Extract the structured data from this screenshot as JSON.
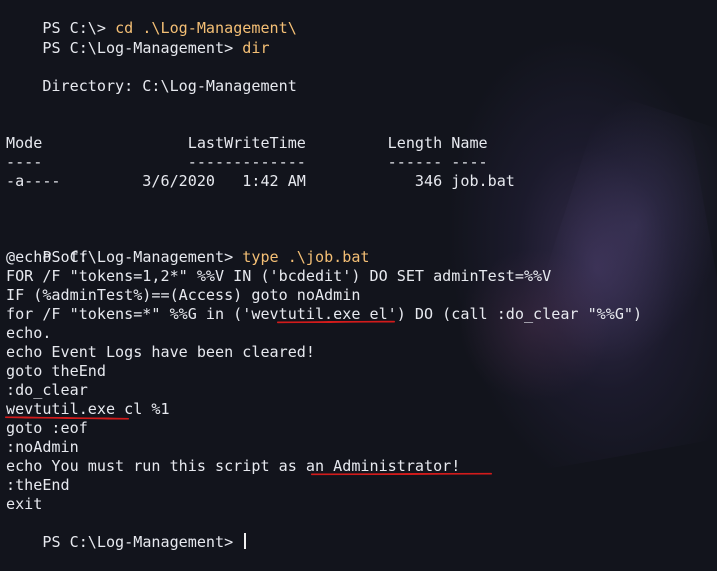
{
  "terminal": {
    "line1": {
      "prompt": "PS C:\\> ",
      "command": "cd .\\Log-Management\\"
    },
    "line2": {
      "prompt": "PS C:\\Log-Management> ",
      "command": "dir"
    },
    "directory_label": "    Directory: C:\\Log-Management",
    "table": {
      "headers": "Mode                LastWriteTime         Length Name",
      "rules": "----                -------------         ------ ----",
      "row": "-a----         3/6/2020   1:42 AM            346 job.bat"
    },
    "line3": {
      "prompt": "PS C:\\Log-Management> ",
      "command": "type .\\job.bat"
    },
    "script_lines": [
      "@echo off",
      "FOR /F \"tokens=1,2*\" %%V IN ('bcdedit') DO SET adminTest=%%V",
      "IF (%adminTest%)==(Access) goto noAdmin",
      "for /F \"tokens=*\" %%G in ('wevtutil.exe el') DO (call :do_clear \"%%G\")",
      "echo.",
      "echo Event Logs have been cleared!",
      "goto theEnd",
      ":do_clear",
      "wevtutil.exe cl %1",
      "goto :eof",
      ":noAdmin",
      "echo You must run this script as an Administrator!",
      ":theEnd",
      "exit"
    ],
    "final_prompt": "PS C:\\Log-Management> "
  },
  "colors": {
    "background": "#12141c",
    "text": "#e7e9ef",
    "command": "#f4bf75",
    "annotation": "#d21b1b"
  }
}
